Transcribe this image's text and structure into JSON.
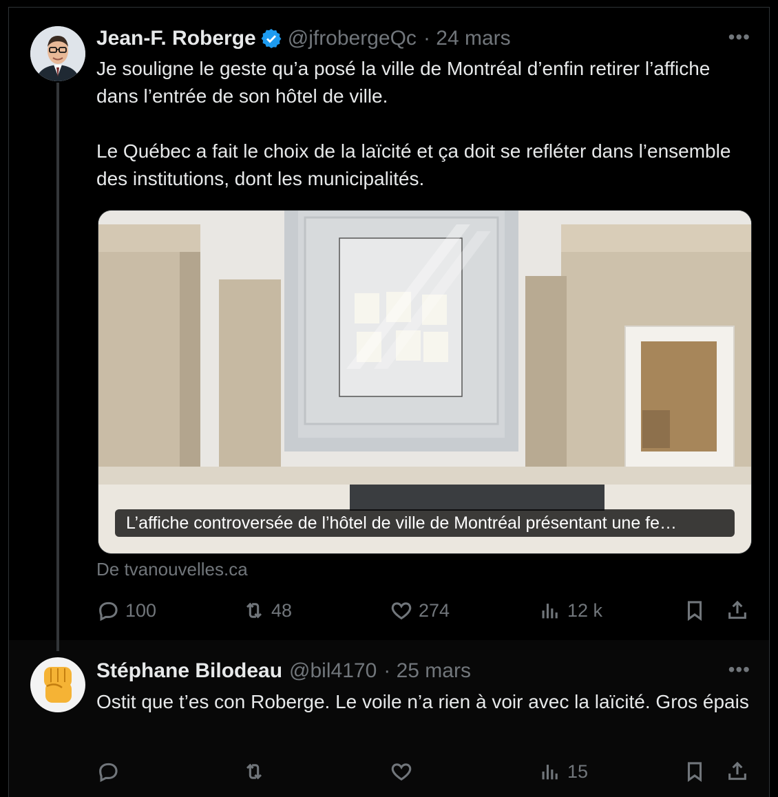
{
  "tweet1": {
    "name": "Jean-F. Roberge",
    "handle": "@jfrobergeQc",
    "date": "· 24 mars",
    "paragraphs": [
      "Je souligne le geste qu’a posé la ville de Montréal d’enfin retirer l’affiche dans l’entrée de son hôtel de ville.",
      "Le Québec a fait le choix de la laïcité et ça doit se refléter dans l’ensemble des institutions, dont les municipalités."
    ],
    "card_caption": "L’affiche controversée de l’hôtel de ville de Montréal présentant une fe…",
    "source": "De tvanouvelles.ca",
    "replies": "100",
    "retweets": "48",
    "likes": "274",
    "views": "12 k"
  },
  "tweet2": {
    "name": "Stéphane Bilodeau",
    "handle": "@bil4170",
    "date": "· 25 mars",
    "text": "Ostit que t’es con Roberge. Le voile n’a rien à voir avec la laïcité. Gros épais",
    "views": "15"
  },
  "more_label": "•••",
  "colors": {
    "accent": "#1d9bf0",
    "muted": "#71767b",
    "text": "#e7e9ea"
  },
  "icons": [
    "verified-badge-icon",
    "reply-icon",
    "retweet-icon",
    "like-icon",
    "views-icon",
    "bookmark-icon",
    "share-icon",
    "raised-fist-emoji"
  ]
}
